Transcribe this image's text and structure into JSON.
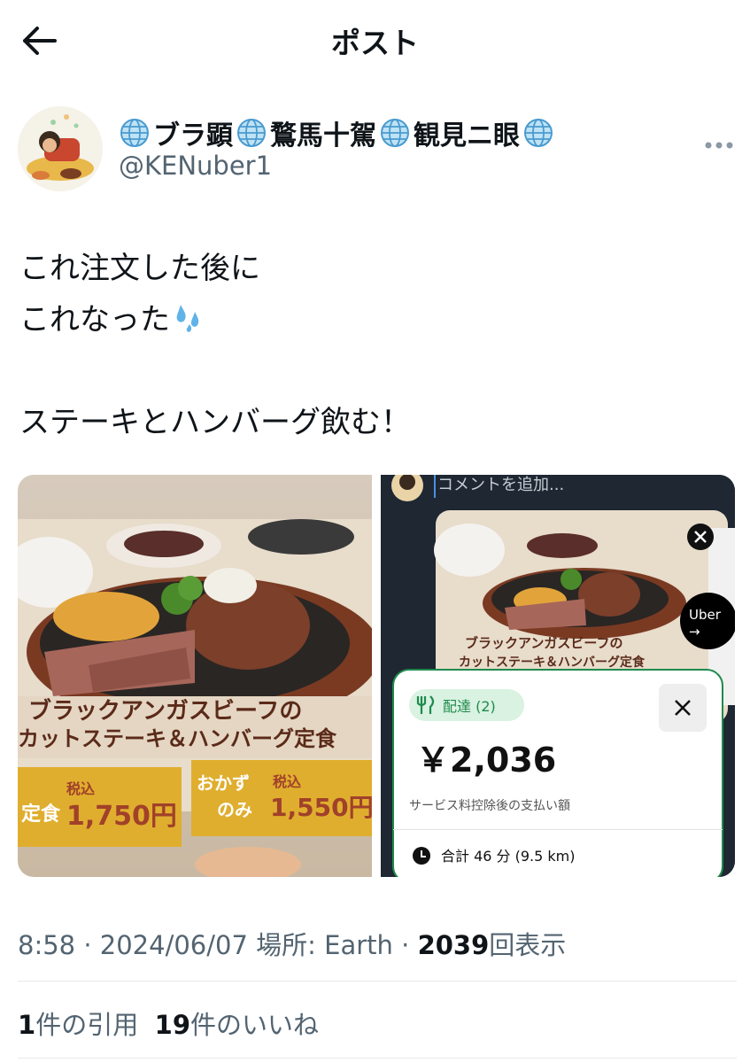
{
  "header": {
    "title": "ポスト"
  },
  "author": {
    "display_name_parts": [
      "ブラ顕",
      "鶩馬十駕",
      "観見ニ眼"
    ],
    "handle": "@KENuber1"
  },
  "tweet": {
    "line1": "これ注文した後に",
    "line2": "これなった",
    "line3": "ステーキとハンバーグ飲む！"
  },
  "left_image": {
    "menu_title_line1": "ブラックアンガスビーフの",
    "menu_title_line2": "カットステーキ＆ハンバーグ定食",
    "price_tag1_prefix": "定食",
    "price_tag1_tax": "税込",
    "price_tag1_price": "1,750円",
    "price_tag2_label1": "おかず",
    "price_tag2_label2": "のみ",
    "price_tag2_tax": "税込",
    "price_tag2_price": "1,550円"
  },
  "right_image": {
    "comment_placeholder": "コメントを追加...",
    "inner_menu_line1": "ブラックアンガスビーフの",
    "inner_menu_line2": "カットステーキ＆ハンバーグ定食",
    "uber_label": "Uber",
    "uber_arrow": "→",
    "delivery_badge": "配達 (2)",
    "amount": "￥2,036",
    "amount_note": "サービス料控除後の支払い額",
    "time_info": "合計 46 分 (9.5 km)"
  },
  "meta": {
    "time": "8:58",
    "sep1": " · ",
    "date": "2024/06/07",
    "location_label": " 場所: Earth",
    "sep2": " · ",
    "views": "2039",
    "views_label": "回表示"
  },
  "stats": {
    "quotes_count": "1",
    "quotes_label": "件の引用",
    "likes_count": "19",
    "likes_label": "件のいいね"
  },
  "colors": {
    "accent_green": "#1f8a4c",
    "badge_green": "#d9f2e1",
    "text_gray": "#536471"
  }
}
